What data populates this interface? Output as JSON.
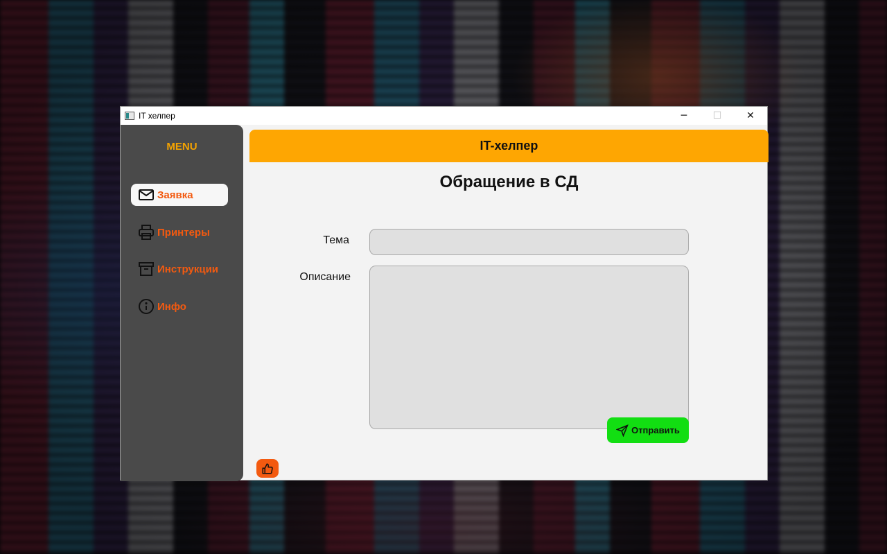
{
  "window": {
    "title": "IT хелпер",
    "controls": {
      "minimize": "─",
      "maximize": "☐",
      "close": "✕"
    }
  },
  "sidebar": {
    "menu_title": "MENU",
    "items": [
      {
        "label": "Заявка",
        "icon": "envelope-icon",
        "active": true
      },
      {
        "label": "Принтеры",
        "icon": "printer-icon",
        "active": false
      },
      {
        "label": "Инструкции",
        "icon": "archive-box-icon",
        "active": false
      },
      {
        "label": "Инфо",
        "icon": "info-circle-icon",
        "active": false
      }
    ]
  },
  "main": {
    "header": "IT-хелпер",
    "title": "Обращение в СД",
    "form": {
      "theme_label": "Тема",
      "theme_value": "",
      "description_label": "Описание",
      "description_value": "",
      "submit_label": "Отправить"
    },
    "like_icon": "thumbs-up-icon"
  },
  "colors": {
    "accent_orange": "#fea602",
    "nav_text": "#f35a10",
    "sidebar_bg": "#4a4a4a",
    "submit_green": "#12de12"
  }
}
